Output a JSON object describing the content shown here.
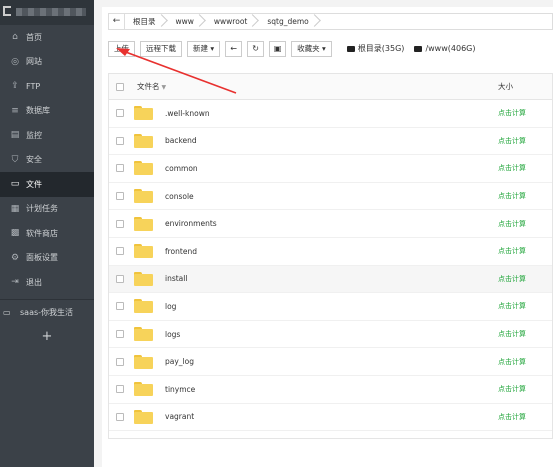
{
  "sidebar": {
    "items": [
      {
        "label": "首页",
        "icon": "home-icon",
        "glyph": "⌂"
      },
      {
        "label": "网站",
        "icon": "globe-icon",
        "glyph": "◎"
      },
      {
        "label": "FTP",
        "icon": "ftp-icon",
        "glyph": "⇪"
      },
      {
        "label": "数据库",
        "icon": "database-icon",
        "glyph": "≡"
      },
      {
        "label": "监控",
        "icon": "monitor-icon",
        "glyph": "▤"
      },
      {
        "label": "安全",
        "icon": "shield-icon",
        "glyph": "⛉"
      },
      {
        "label": "文件",
        "icon": "folder-icon",
        "glyph": "▭"
      },
      {
        "label": "计划任务",
        "icon": "calendar-icon",
        "glyph": "▦"
      },
      {
        "label": "软件商店",
        "icon": "apps-icon",
        "glyph": "▩"
      },
      {
        "label": "面板设置",
        "icon": "gear-icon",
        "glyph": "⚙"
      },
      {
        "label": "退出",
        "icon": "logout-icon",
        "glyph": "⇥"
      }
    ],
    "active_index": 6,
    "saas_label": "saas-你我生活",
    "add_glyph": "+"
  },
  "pathbar": {
    "back_glyph": "←",
    "crumbs": [
      "根目录",
      "www",
      "wwwroot",
      "sqtg_demo"
    ]
  },
  "toolbar": {
    "upload": "上传",
    "remote_download": "远程下载",
    "new": "新建 ▾",
    "back_glyph": "←",
    "refresh_glyph": "↻",
    "terminal_glyph": "▣",
    "favorites": "收藏夹 ▾",
    "disk_root": "根目录(35G)",
    "disk_www": "/www(406G)"
  },
  "table": {
    "col_name": "文件名",
    "col_size": "大小",
    "sort_glyph": "▼",
    "calc_label": "点击计算",
    "rows": [
      ".well-known",
      "backend",
      "common",
      "console",
      "environments",
      "frontend",
      "install",
      "log",
      "logs",
      "pay_log",
      "tinymce",
      "vagrant"
    ],
    "highlight_index": 6
  },
  "colors": {
    "sidebar_bg": "#3b4148",
    "accent_green": "#20a53a",
    "arrow_red": "#e8312f",
    "folder_yellow": "#f7d35a"
  }
}
